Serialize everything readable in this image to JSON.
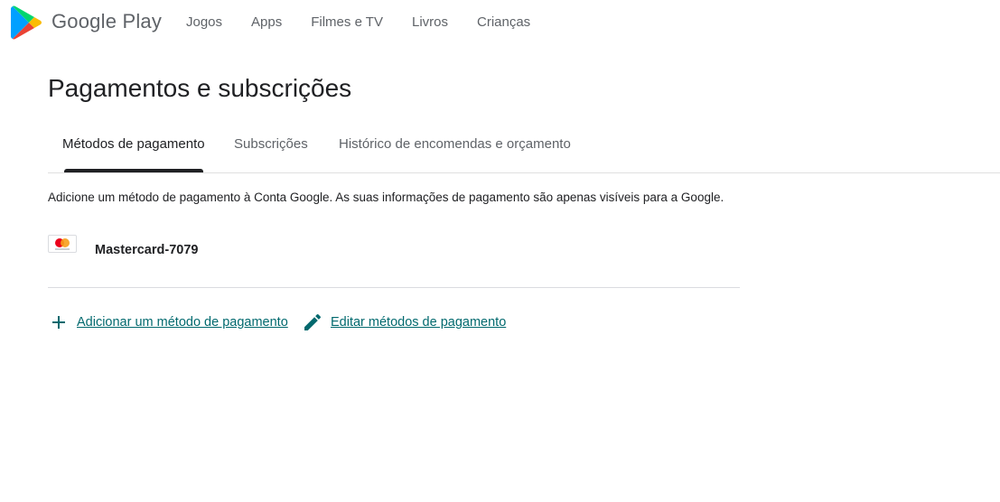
{
  "header": {
    "brand": "Google Play",
    "nav": [
      "Jogos",
      "Apps",
      "Filmes e TV",
      "Livros",
      "Crianças"
    ]
  },
  "page": {
    "title": "Pagamentos e subscrições",
    "tabs": [
      {
        "label": "Métodos de pagamento",
        "active": true
      },
      {
        "label": "Subscrições",
        "active": false
      },
      {
        "label": "Histórico de encomendas e orçamento",
        "active": false
      }
    ],
    "description": "Adicione um método de pagamento à Conta Google. As suas informações de pagamento são apenas visíveis para a Google."
  },
  "payment_methods": [
    {
      "name": "Mastercard-7079",
      "icon": "mastercard-icon"
    }
  ],
  "actions": {
    "add_label": "Adicionar um método de pagamento",
    "edit_label": "Editar métodos de pagamento"
  },
  "colors": {
    "accent": "#01696e",
    "text": "#202124",
    "muted": "#5f6368",
    "divider": "#dadce0"
  }
}
